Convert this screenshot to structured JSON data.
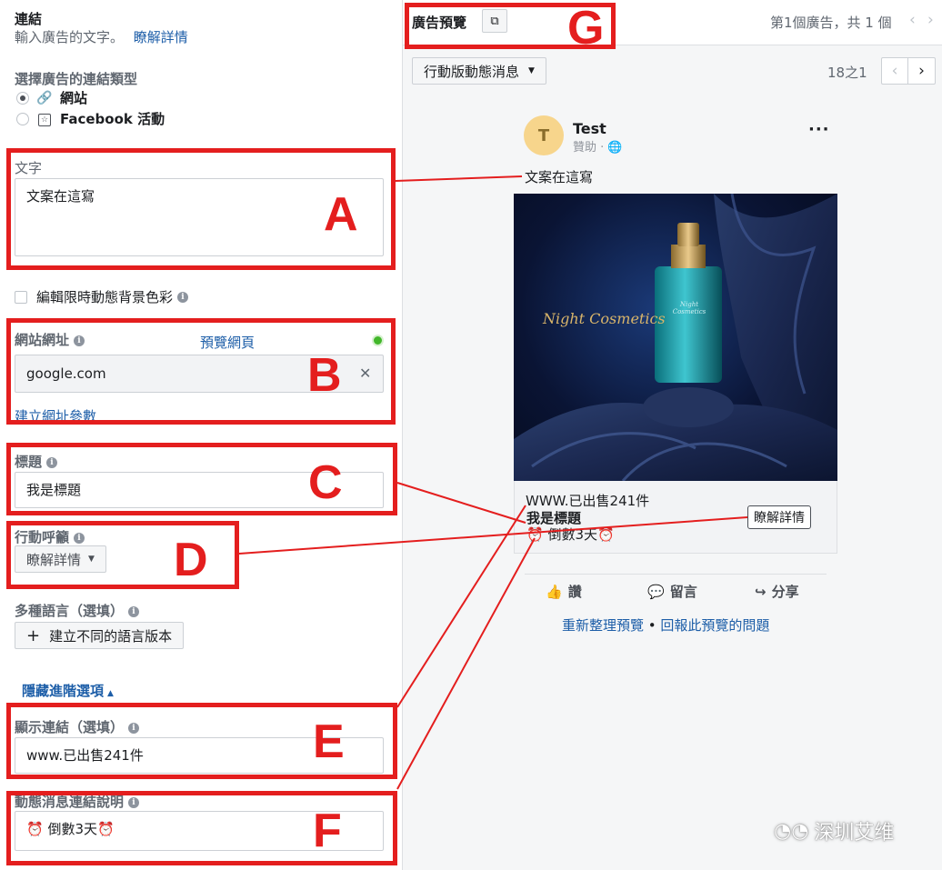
{
  "left": {
    "section_title": "連結",
    "section_sub": "輸入廣告的文字。",
    "learn_more_link": "瞭解詳情",
    "link_type_label": "選擇廣告的連結類型",
    "link_types": [
      {
        "label": "網站",
        "icon": "link-icon",
        "selected": true
      },
      {
        "label": "Facebook 活動",
        "icon": "event-icon",
        "selected": false
      }
    ],
    "text_label": "文字",
    "text_value": "文案在這寫",
    "story_bg_checkbox": "編輯限時動態背景色彩",
    "url_label": "網站網址",
    "preview_url_link": "預覽網頁",
    "url_value": "google.com",
    "url_params_link": "建立網址參數",
    "headline_label": "標題",
    "headline_value": "我是標題",
    "cta_label": "行動呼籲",
    "cta_value": "瞭解詳情",
    "multi_lang_label": "多種語言（選填）",
    "multi_lang_button": "建立不同的語言版本",
    "hide_advanced": "隱藏進階選項",
    "display_link_label": "顯示連結（選填）",
    "display_link_value": "www.已出售241件",
    "feed_desc_label": "動態消息連結說明",
    "feed_desc_value": "⏰ 倒數3天⏰"
  },
  "preview": {
    "title": "廣告預覽",
    "counter": "第1個廣告，共 1 個",
    "placement": "行動版動態消息",
    "page_count": "18之1",
    "page_name": "Test",
    "avatar_letter": "T",
    "sponsored": "贊助 · ",
    "post_text": "文案在這寫",
    "image_brand": "Night Cosmetics",
    "image_bottle_text": "Night Cosmetics",
    "link_caption": "WWW.已出售241件",
    "link_headline": "我是標題",
    "link_desc": "⏰ 倒數3天⏰",
    "cta_button": "瞭解詳情",
    "like": "讚",
    "comment": "留言",
    "share": "分享",
    "refresh": "重新整理預覽",
    "report": "回報此預覽的問題",
    "bullet": " • "
  },
  "annotations": {
    "A": "A",
    "B": "B",
    "C": "C",
    "D": "D",
    "E": "E",
    "F": "F",
    "G": "G"
  },
  "watermark": "深圳艾维",
  "colors": {
    "annotation_red": "#e41e1e",
    "link_blue": "#1d5ea8",
    "avatar_bg": "#f7d58c",
    "green_dot": "#42b72a"
  }
}
